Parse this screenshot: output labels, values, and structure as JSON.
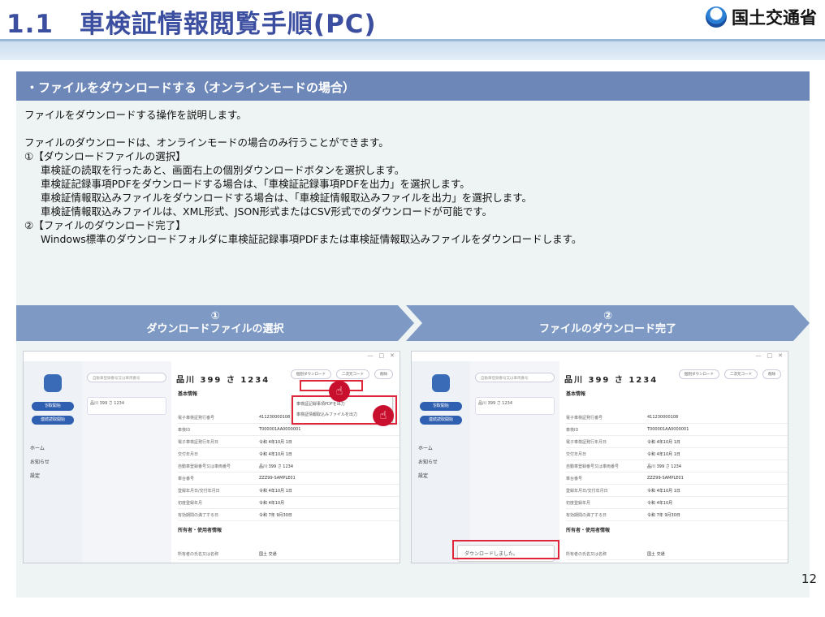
{
  "header": {
    "title": "1.1　車検証情報閲覧手順(PC)",
    "logo_text": "国土交通省"
  },
  "section": {
    "heading": "・ファイルをダウンロードする（オンラインモードの場合）"
  },
  "body": {
    "intro": "ファイルをダウンロードする操作を説明します。",
    "note": "ファイルのダウンロードは、オンラインモードの場合のみ行うことができます。",
    "step1_title": "①【ダウンロードファイルの選択】",
    "step1_lines": [
      "車検証の読取を行ったあと、画面右上の個別ダウンロードボタンを選択します。",
      "車検証記録事項PDFをダウンロードする場合は、「車検証記録事項PDFを出力」を選択します。",
      "車検証情報取込みファイルをダウンロードする場合は、「車検証情報取込みファイルを出力」を選択します。",
      "車検証情報取込みファイルは、XML形式、JSON形式またはCSV形式でのダウンロードが可能です。"
    ],
    "step2_title": "②【ファイルのダウンロード完了】",
    "step2_lines": [
      "Windows標準のダウンロードフォルダに車検証記録事項PDFまたは車検証情報取込みファイルをダウンロードします。"
    ]
  },
  "flow": [
    {
      "num": "①",
      "label": "ダウンロードファイルの選択"
    },
    {
      "num": "②",
      "label": "ファイルのダウンロード完了"
    }
  ],
  "app": {
    "search_placeholder": "自動車登録番号又は車両番号",
    "plate": "品川 399 さ 1234",
    "side_btn1": "읽取開始",
    "side_btn2": "連続読取開始",
    "nav": [
      "ホーム",
      "お知らせ",
      "設定"
    ],
    "section_basic": "基本情報",
    "section_owner": "所有者・使用者情報",
    "rows": [
      {
        "k": "電子車検証発行番号",
        "v": "411230000108"
      },
      {
        "k": "車検ID",
        "v": "T000001AA0000001"
      },
      {
        "k": "電子車検証発行年月日",
        "v": "令和 4年10月 1日"
      },
      {
        "k": "交付年月日",
        "v": "令和 4年10月 1日"
      },
      {
        "k": "自動車登録番号又は車両番号",
        "v": "品川 399 さ 1234"
      },
      {
        "k": "車台番号",
        "v": "ZZZ99-SAMPLE01"
      },
      {
        "k": "登録年月日/交付年月日",
        "v": "令和 4年10月 1日"
      },
      {
        "k": "初度登録年月",
        "v": "令和 4年10月"
      },
      {
        "k": "有効期間の満了する日",
        "v": "令和 7年 9月30日"
      }
    ],
    "owner_row": {
      "k": "所有者の氏名又は名称",
      "v": "国土 交通"
    },
    "btn_download": "個別ダウンロード",
    "btn_qr": "二次元コード",
    "btn_delete": "削除",
    "menu_pdf": "車検証記録事項PDFを出力",
    "menu_file": "車検証情報取込みファイルを出力",
    "toast": "ダウンロードしました。"
  },
  "page_number": "12"
}
